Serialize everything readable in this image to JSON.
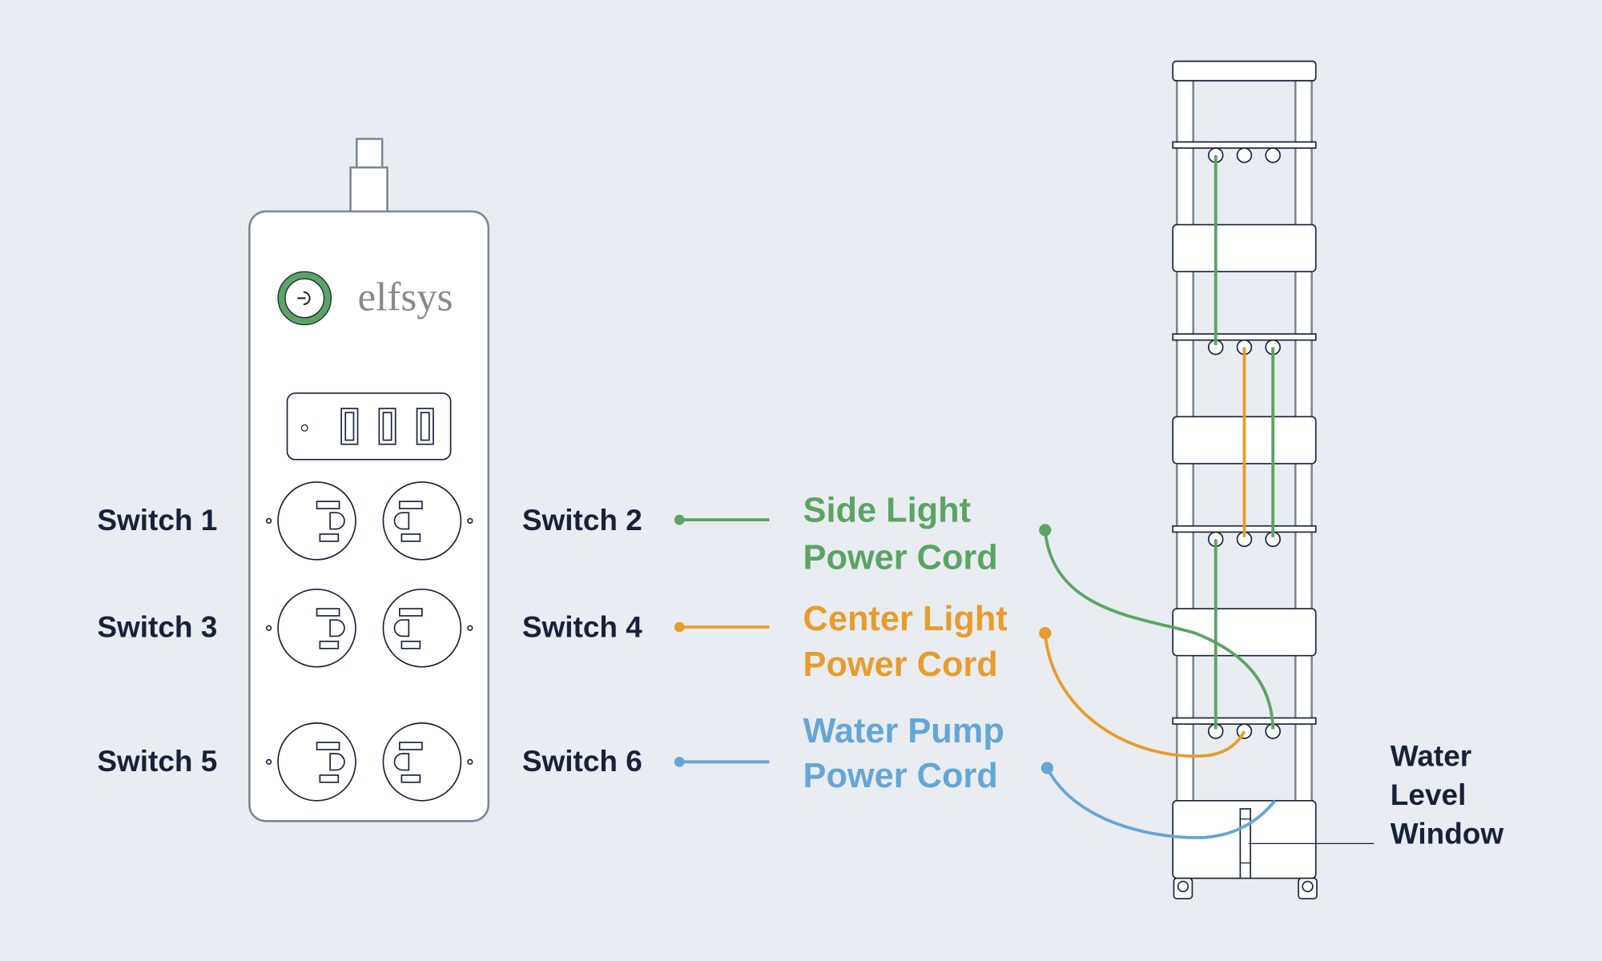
{
  "brand": "elfsys",
  "colors": {
    "background": "#e9edf1",
    "ink": "#17213a",
    "green": "#5ba463",
    "orange": "#e89c2c",
    "blue": "#64a6d6",
    "gray_outline": "#7b8594"
  },
  "icons": {
    "power_button": "power-icon"
  },
  "switches": {
    "s1": "Switch 1",
    "s2": "Switch 2",
    "s3": "Switch 3",
    "s4": "Switch 4",
    "s5": "Switch 5",
    "s6": "Switch 6"
  },
  "cords": {
    "side_light": {
      "line1": "Side Light",
      "line2": "Power Cord",
      "switch": "Switch 2"
    },
    "center_light": {
      "line1": "Center Light",
      "line2": "Power Cord",
      "switch": "Switch 4"
    },
    "water_pump": {
      "line1": "Water Pump",
      "line2": "Power Cord",
      "switch": "Switch 6"
    }
  },
  "callout": {
    "line1": "Water",
    "line2": "Level",
    "line3": "Window"
  }
}
